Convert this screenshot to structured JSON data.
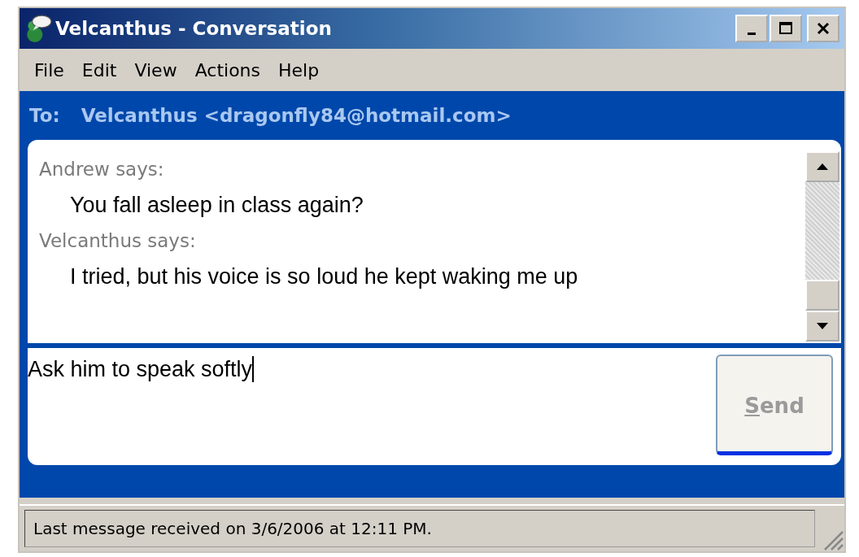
{
  "window": {
    "title": "Velcanthus - Conversation"
  },
  "menu": [
    "File",
    "Edit",
    "View",
    "Actions",
    "Help"
  ],
  "to": {
    "label": "To:",
    "contact": "Velcanthus <dragonfly84@hotmail.com>"
  },
  "messages": [
    {
      "sender": "Andrew says:",
      "text": "You fall asleep in class again?"
    },
    {
      "sender": "Velcanthus says:",
      "text": "I tried, but his voice is so loud he kept waking me up"
    }
  ],
  "compose": {
    "value": "Ask him to speak softly"
  },
  "send_button": {
    "label": "Send",
    "disabled": true
  },
  "status_bar": "Last message received on 3/6/2006 at 12:11 PM."
}
